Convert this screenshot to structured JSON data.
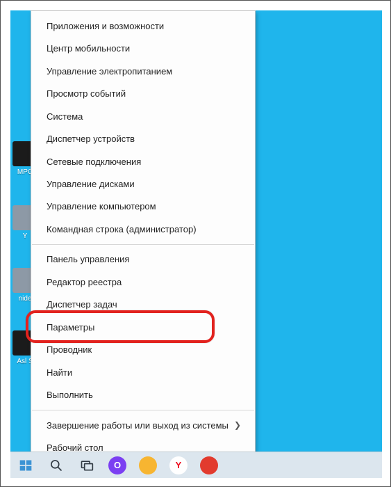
{
  "desktop_icons": [
    {
      "label": "MPC"
    },
    {
      "label": "Y"
    },
    {
      "label": "nide"
    },
    {
      "label": "Asl S"
    }
  ],
  "context_menu": {
    "groups": [
      [
        {
          "id": "apps-features",
          "label": "Приложения и возможности"
        },
        {
          "id": "mobility-center",
          "label": "Центр мобильности"
        },
        {
          "id": "power-options",
          "label": "Управление электропитанием"
        },
        {
          "id": "event-viewer",
          "label": "Просмотр событий"
        },
        {
          "id": "system",
          "label": "Система"
        },
        {
          "id": "device-manager",
          "label": "Диспетчер устройств"
        },
        {
          "id": "network-conn",
          "label": "Сетевые подключения"
        },
        {
          "id": "disk-mgmt",
          "label": "Управление дисками"
        },
        {
          "id": "computer-mgmt",
          "label": "Управление компьютером"
        },
        {
          "id": "cmd-admin",
          "label": "Командная строка (администратор)"
        }
      ],
      [
        {
          "id": "control-panel",
          "label": "Панель управления"
        },
        {
          "id": "regedit",
          "label": "Редактор реестра"
        },
        {
          "id": "task-manager",
          "label": "Диспетчер задач"
        },
        {
          "id": "settings",
          "label": "Параметры",
          "highlighted": true
        },
        {
          "id": "explorer",
          "label": "Проводник"
        },
        {
          "id": "find",
          "label": "Найти"
        },
        {
          "id": "run",
          "label": "Выполнить"
        }
      ],
      [
        {
          "id": "shutdown-signout",
          "label": "Завершение работы или выход из системы",
          "submenu": true
        },
        {
          "id": "desktop",
          "label": "Рабочий стол"
        }
      ]
    ]
  },
  "taskbar": {
    "start": "Start",
    "search": "Search",
    "taskview": "Task view",
    "apps": [
      {
        "id": "app-opera",
        "glyph": "O",
        "bg": "#7b3ff2"
      },
      {
        "id": "app-files",
        "glyph": "",
        "bg": "#f7b531"
      },
      {
        "id": "app-yandex",
        "glyph": "Y",
        "bg": "#ffffff",
        "fg": "#e12"
      },
      {
        "id": "app-red",
        "glyph": "",
        "bg": "#e23b2e"
      }
    ]
  },
  "colors": {
    "desktop_bg": "#1fb5ec",
    "menu_bg": "#fdfdfd",
    "highlight": "#e2221e"
  }
}
